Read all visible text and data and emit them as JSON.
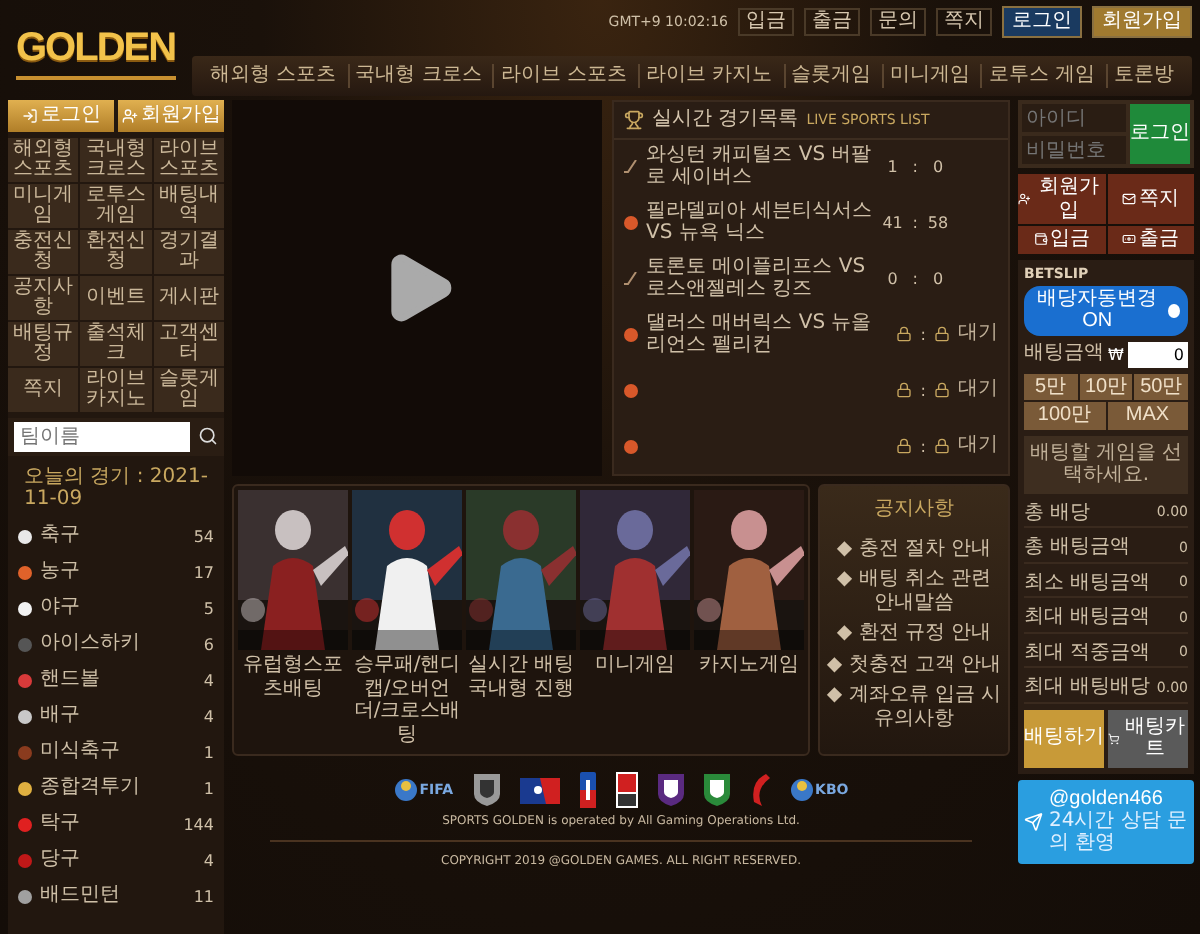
{
  "header": {
    "logo": "GOLDEN",
    "clock": "GMT+9 10:02:16",
    "utility_links": [
      "입금",
      "출금",
      "문의",
      "쪽지"
    ],
    "login_button": "로그인",
    "join_button": "회원가입"
  },
  "nav": [
    "해외형 스포츠",
    "국내형 크로스",
    "라이브 스포츠",
    "라이브 카지노",
    "슬롯게임",
    "미니게임",
    "로투스 게임",
    "토론방"
  ],
  "left_sidebar": {
    "top_buttons": [
      "로그인",
      "회원가입"
    ],
    "menu": [
      "해외형 스포츠",
      "국내형 크로스",
      "라이브 스포츠",
      "미니게임",
      "로투스게임",
      "배팅내역",
      "충전신청",
      "환전신청",
      "경기결과",
      "공지사항",
      "이벤트",
      "게시판",
      "배팅규정",
      "출석체크",
      "고객센터",
      "쪽지",
      "라이브 카지노",
      "슬롯게임"
    ],
    "search": {
      "placeholder": "팀이름"
    },
    "today": "오늘의 경기 : 2021-11-09",
    "sports": [
      {
        "name": "축구",
        "count": "54",
        "color": "#e8e8e8"
      },
      {
        "name": "농구",
        "count": "17",
        "color": "#e0622a"
      },
      {
        "name": "야구",
        "count": "5",
        "color": "#f2f2f2"
      },
      {
        "name": "아이스하키",
        "count": "6",
        "color": "#555555"
      },
      {
        "name": "핸드볼",
        "count": "4",
        "color": "#d83a3a"
      },
      {
        "name": "배구",
        "count": "4",
        "color": "#c8c8c8"
      },
      {
        "name": "미식축구",
        "count": "1",
        "color": "#8a3b1e"
      },
      {
        "name": "종합격투기",
        "count": "1",
        "color": "#e0b040"
      },
      {
        "name": "탁구",
        "count": "144",
        "color": "#e02020"
      },
      {
        "name": "당구",
        "count": "4",
        "color": "#c01818"
      },
      {
        "name": "배드민턴",
        "count": "11",
        "color": "#a0a0a0"
      }
    ]
  },
  "live_list": {
    "title": "실시간 경기목록",
    "subtitle": "LIVE SPORTS LIST",
    "separator": ":",
    "rows": [
      {
        "kind": "hockey",
        "match": "와싱턴 캐피털즈 VS 버팔로 세이버스",
        "home": "1",
        "away": "0",
        "locked": false
      },
      {
        "kind": "basketball",
        "match": "필라델피아 세븐티식서스 VS 뉴욕 닉스",
        "home": "41",
        "away": "58",
        "locked": false
      },
      {
        "kind": "hockey",
        "match": "토론토 메이플리프스 VS 로스앤젤레스 킹즈",
        "home": "0",
        "away": "0",
        "locked": false
      },
      {
        "kind": "basketball",
        "match": "댈러스 매버릭스 VS 뉴올리언스 펠리컨",
        "locked": true,
        "status": "대기"
      },
      {
        "kind": "basketball",
        "locked": true,
        "status": "대기"
      },
      {
        "kind": "basketball",
        "locked": true,
        "status": "대기"
      }
    ]
  },
  "game_cards": [
    {
      "label": "유럽형스포츠배팅"
    },
    {
      "label": "승무패/핸디캡/오버언더/크로스배팅"
    },
    {
      "label": "실시간 배팅 국내형 진행"
    },
    {
      "label": "미니게임"
    },
    {
      "label": "카지노게임"
    }
  ],
  "notice": {
    "title": "공지사항",
    "bullet": "◆",
    "items": [
      "충전 절차 안내",
      "배팅 취소 관련 안내말씀",
      "환전 규정 안내",
      "첫충전 고객 안내",
      "계좌오류 입금 시 유의사항"
    ]
  },
  "right_sidebar": {
    "login": {
      "id_placeholder": "아이디",
      "pw_placeholder": "비밀번호",
      "button": "로그인"
    },
    "account_buttons": [
      "회원가입",
      "쪽지",
      "입금",
      "출금"
    ],
    "betslip": {
      "title": "BETSLIP",
      "auto_odds": {
        "label": "배당자동변경 ON",
        "on": true
      },
      "amount_label": "배팅금액",
      "currency": "₩",
      "amount_value": "0",
      "quick_amounts": [
        "5만",
        "10만",
        "50만",
        "100만",
        "MAX"
      ],
      "message": "배팅할 게임을 선택하세요.",
      "summary": [
        {
          "label": "총 배당",
          "value": "0.00"
        },
        {
          "label": "총 배팅금액",
          "value": "0"
        },
        {
          "label": "최소 배팅금액",
          "value": "0"
        },
        {
          "label": "최대 배팅금액",
          "value": "0"
        },
        {
          "label": "최대 적중금액",
          "value": "0"
        },
        {
          "label": "최대 배팅배당",
          "value": "0.00"
        }
      ],
      "bet_button": "배팅하기",
      "cart_button": "배팅카트"
    },
    "telegram": {
      "handle": "@golden466",
      "caption": "24시간 상담 문의 환영"
    }
  },
  "footer": {
    "leagues": [
      {
        "kind": "globe",
        "label": "FIFA"
      },
      {
        "kind": "shield-grey"
      },
      {
        "kind": "flag-blue"
      },
      {
        "kind": "bar-blue"
      },
      {
        "kind": "square-red"
      },
      {
        "kind": "shield-purple"
      },
      {
        "kind": "shield-green"
      },
      {
        "kind": "swoosh-red"
      },
      {
        "kind": "globe",
        "label": "KBO"
      }
    ],
    "operator": "SPORTS GOLDEN is operated by All Gaming Operations Ltd.",
    "copyright": "COPYRIGHT 2019 @GOLDEN GAMES. ALL RIGHT RESERVED."
  }
}
